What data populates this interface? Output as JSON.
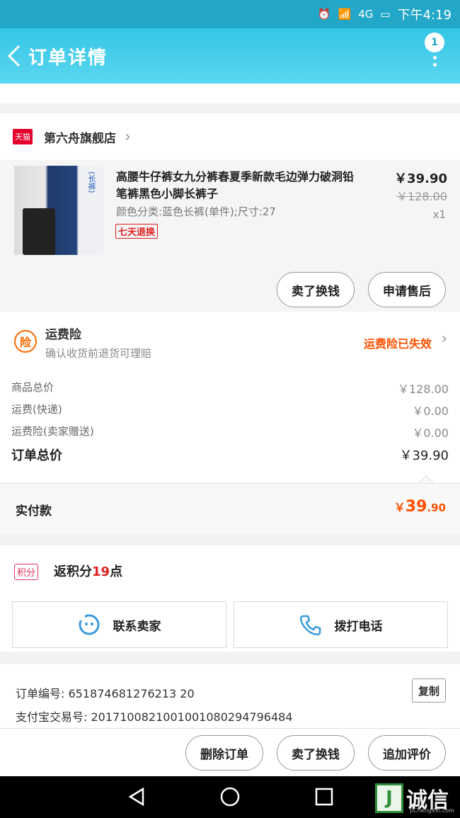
{
  "status_bar": {
    "time": "下午4:19",
    "network": "4G"
  },
  "header": {
    "title": "订单详情",
    "badge_count": "1"
  },
  "store": {
    "logo_text": "天猫",
    "name": "第六舟旗舰店"
  },
  "product": {
    "title": "高腰牛仔裤女九分裤春夏季新款毛边弹力破洞铅笔裤黑色小脚长裤子",
    "sku": "颜色分类:蓝色长裤(单件);尺寸:27",
    "tag": "七天退换",
    "price_now": "￥39.90",
    "price_old": "￥128.00",
    "qty": "x1",
    "image_tag": "(长裤)"
  },
  "actions": {
    "sell_exchange": "卖了换钱",
    "after_sales": "申请售后"
  },
  "insurance": {
    "icon": "险",
    "title": "运费险",
    "subtitle": "确认收货前退货可理赔",
    "status": "运费险已失效"
  },
  "costs": {
    "items": [
      {
        "label": "商品总价",
        "value": "￥128.00"
      },
      {
        "label": "运费(快递)",
        "value": "￥0.00"
      },
      {
        "label": "运费险(卖家赠送)",
        "value": "￥0.00"
      }
    ],
    "total_label": "订单总价",
    "total_value": "￥39.90"
  },
  "paid": {
    "label": "实付款",
    "currency": "￥",
    "integer": "39",
    "decimal": ".90"
  },
  "points": {
    "icon": "积分",
    "prefix": "返积分",
    "value": "19",
    "suffix": "点"
  },
  "contact": {
    "seller": "联系卖家",
    "call": "拨打电话"
  },
  "info": {
    "order_no": "订单编号: 651874681276213 20",
    "alipay_no": "支付宝交易号: 2017100821001001080294796484",
    "copy": "复制"
  },
  "bottom": {
    "delete": "删除订单",
    "sell_exchange": "卖了换钱",
    "review": "追加评价"
  },
  "watermark": {
    "logo": "J",
    "text": "诚信",
    "sub": "JiChengXin.com"
  },
  "colors": {
    "header": "#35c6e6",
    "accent": "#ff5000",
    "tmall": "#e4002b"
  }
}
